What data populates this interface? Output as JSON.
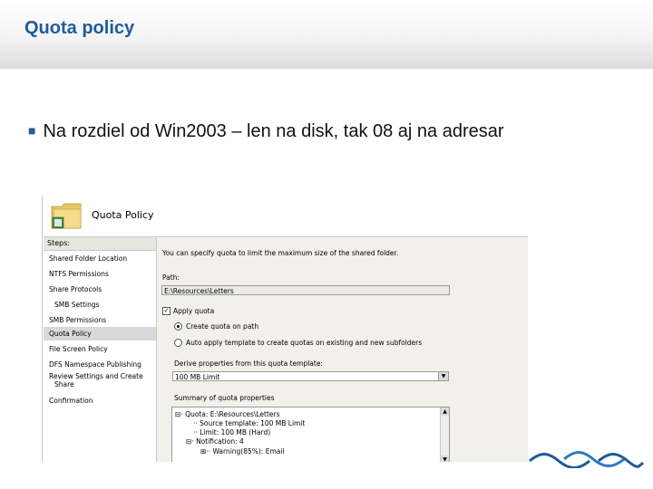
{
  "slide": {
    "title": "Quota policy",
    "bullet": "Na rozdiel od Win2003 – len na disk, tak 08 aj na adresar"
  },
  "wizard": {
    "title": "Quota Policy",
    "steps_heading": "Steps:",
    "steps": [
      "Shared Folder Location",
      "NTFS Permissions",
      "Share Protocols",
      "SMB Settings",
      "SMB Permissions",
      "Quota Policy",
      "File Screen Policy",
      "DFS Namespace Publishing",
      "Review Settings and Create",
      "Share",
      "Confirmation"
    ],
    "intro": "You can specify quota to limit the maximum size of the shared folder.",
    "path_label": "Path:",
    "path_value": "E:\\Resources\\Letters",
    "apply_quota_label": "Apply quota",
    "radio_create": "Create quota on path",
    "radio_auto": "Auto apply template to create quotas on existing and new subfolders",
    "derive_label": "Derive properties from this quota template:",
    "derive_value": "100 MB Limit",
    "summary_label": "Summary of quota properties",
    "tree": [
      "Quota: E:\\Resources\\Letters",
      "Source template: 100 MB Limit",
      "Limit: 100 MB (Hard)",
      "Notification: 4",
      "Warning(85%): Email"
    ]
  }
}
